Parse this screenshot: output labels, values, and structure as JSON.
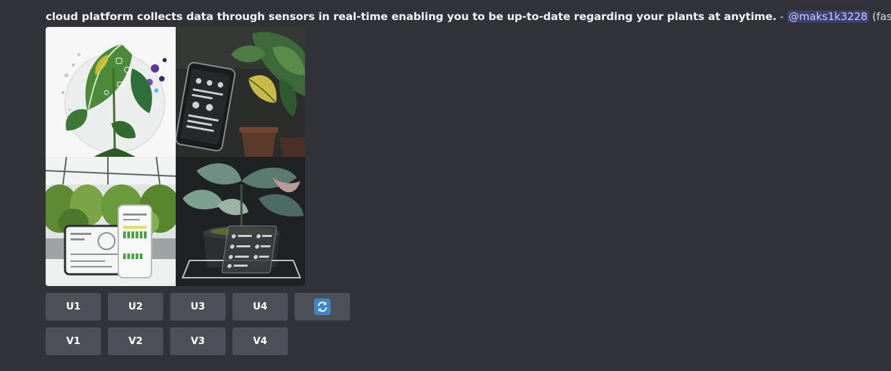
{
  "message": {
    "prompt": "cloud platform collects data through sensors in real-time enabling you to be up-to-date regarding your plants at anytime.",
    "separator": " - ",
    "mention": "@maks1k3228",
    "speed": "(fast)"
  },
  "image": {
    "cells": [
      {
        "name": "leaf-with-data-circuits"
      },
      {
        "name": "plant-with-tablet-dashboard"
      },
      {
        "name": "greenhouse-with-tablet-and-phone"
      },
      {
        "name": "potted-plant-with-glass-display"
      }
    ]
  },
  "buttons": {
    "upscale": [
      "U1",
      "U2",
      "U3",
      "U4"
    ],
    "variation": [
      "V1",
      "V2",
      "V3",
      "V4"
    ],
    "reroll_icon": "refresh-icon"
  },
  "colors": {
    "background": "#313338",
    "button": "#4e5058",
    "mention_bg": "#3c4270",
    "refresh_icon": "#3b88c3"
  }
}
